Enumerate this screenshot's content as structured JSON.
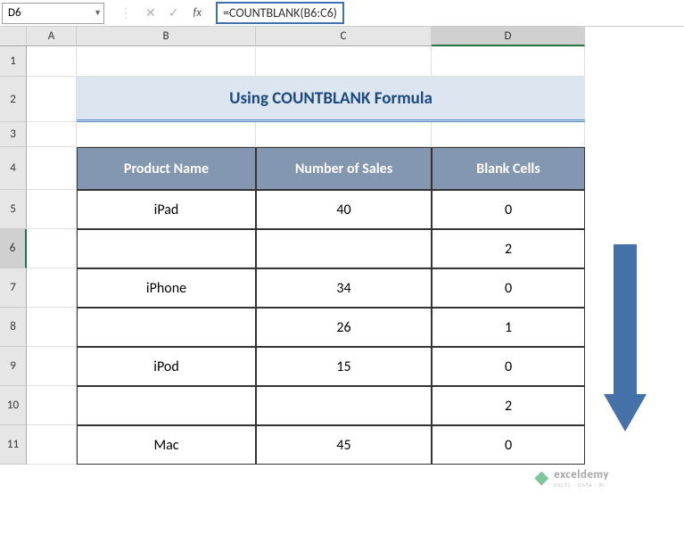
{
  "nameBox": "D6",
  "formula": "=COUNTBLANK(B6:C6)",
  "fxLabel": "fx",
  "columns": [
    "A",
    "B",
    "C",
    "D"
  ],
  "rows": [
    "1",
    "2",
    "3",
    "4",
    "5",
    "6",
    "7",
    "8",
    "9",
    "10",
    "11"
  ],
  "title": "Using COUNTBLANK Formula",
  "table": {
    "headers": [
      "Product Name",
      "Number of Sales",
      "Blank Cells"
    ],
    "rows": [
      {
        "name": "iPad",
        "sales": "40",
        "blank": "0"
      },
      {
        "name": "",
        "sales": "",
        "blank": "2"
      },
      {
        "name": "iPhone",
        "sales": "34",
        "blank": "0"
      },
      {
        "name": "",
        "sales": "26",
        "blank": "1"
      },
      {
        "name": "iPod",
        "sales": "15",
        "blank": "0"
      },
      {
        "name": "",
        "sales": "",
        "blank": "2"
      },
      {
        "name": "Mac",
        "sales": "45",
        "blank": "0"
      }
    ]
  },
  "watermark": {
    "brand": "exceldemy",
    "tagline": "EXCEL · DATA · BI"
  }
}
